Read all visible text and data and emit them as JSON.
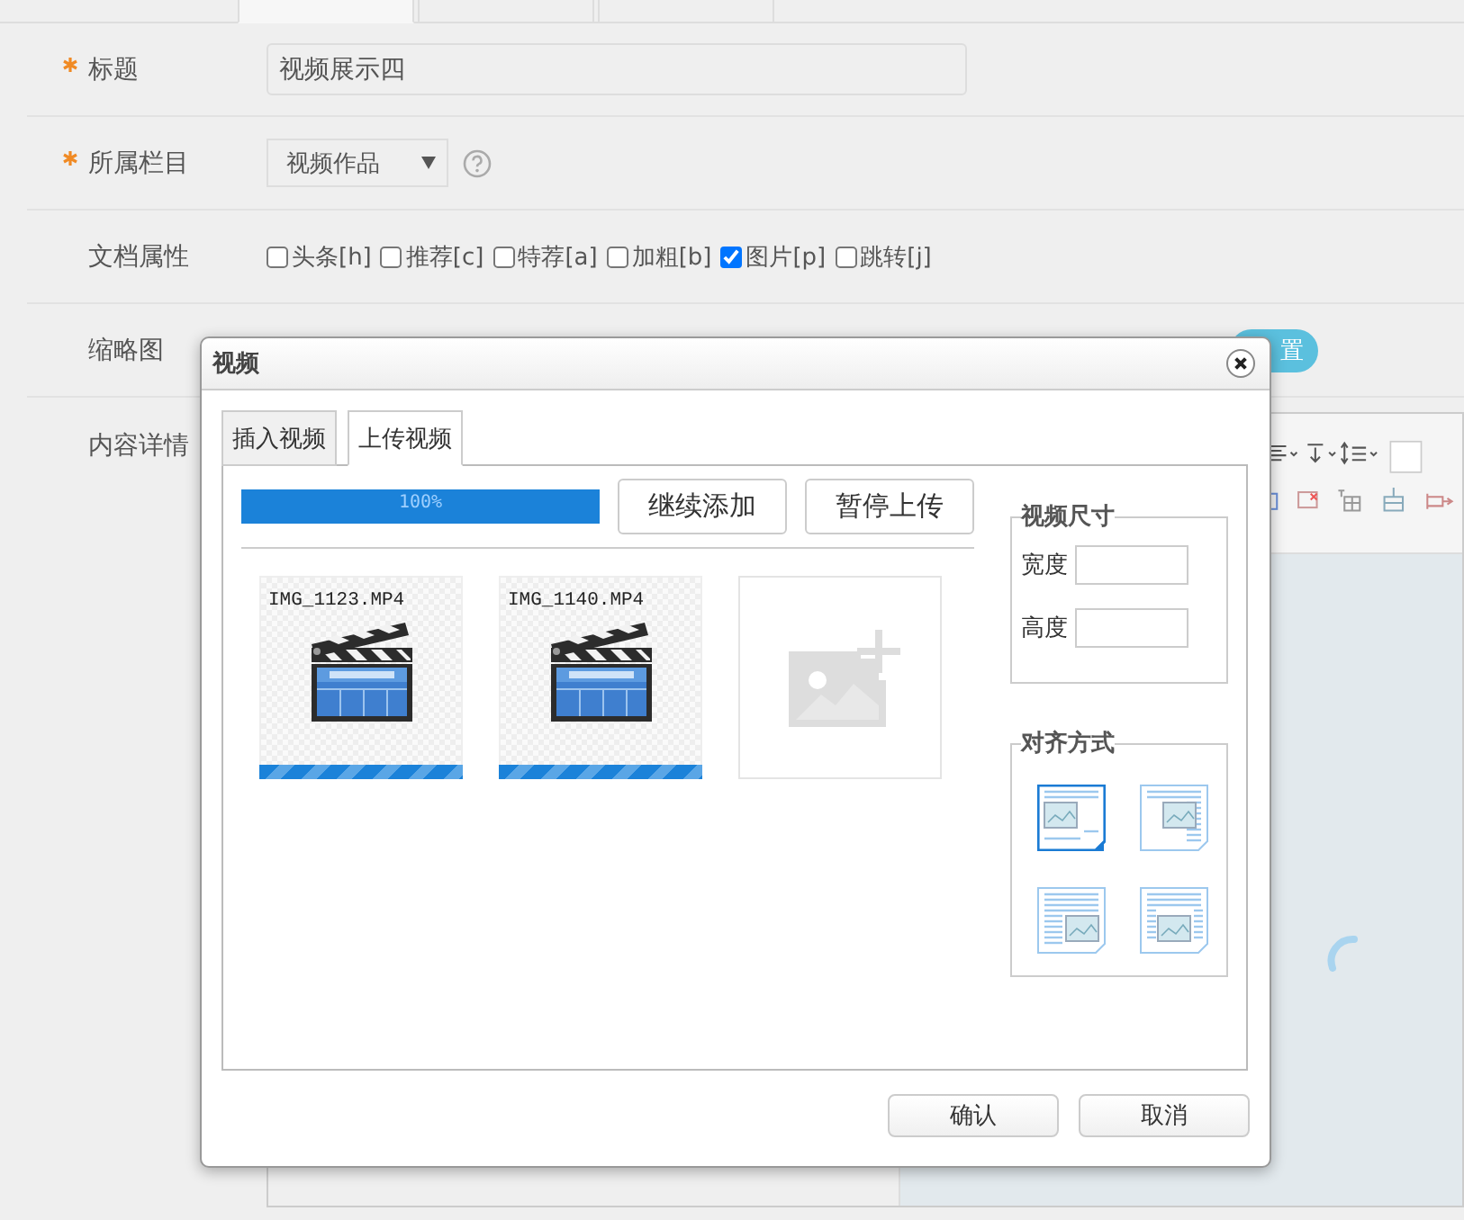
{
  "page_tabs": [
    {
      "selected": true
    },
    {
      "selected": false
    },
    {
      "selected": false
    }
  ],
  "form": {
    "rows": [
      {
        "kind": "text",
        "label": "标题",
        "required": true,
        "value": "视频展示四"
      },
      {
        "kind": "select",
        "label": "所属栏目",
        "required": true,
        "value": "视频作品"
      },
      {
        "kind": "checks",
        "label": "文档属性",
        "required": false,
        "options": [
          {
            "label": "头条[h]",
            "checked": false
          },
          {
            "label": "推荐[c]",
            "checked": false
          },
          {
            "label": "特荐[a]",
            "checked": false
          },
          {
            "label": "加粗[b]",
            "checked": false
          },
          {
            "label": "图片[p]",
            "checked": true
          },
          {
            "label": "跳转[j]",
            "checked": false
          }
        ]
      },
      {
        "kind": "thumb",
        "label": "缩略图",
        "required": false,
        "button": "置"
      },
      {
        "kind": "editor",
        "label": "内容详情",
        "required": false
      }
    ]
  },
  "dialog": {
    "title": "视频",
    "tabs": [
      {
        "label": "插入视频",
        "selected": false
      },
      {
        "label": "上传视频",
        "selected": true
      }
    ],
    "progress": {
      "level": 1,
      "reading": "100%"
    },
    "actions": [
      "继续添加",
      "暂停上传"
    ],
    "files": [
      {
        "kind": "video",
        "name": "IMG_1123.MP4"
      },
      {
        "kind": "video",
        "name": "IMG_1140.MP4"
      },
      {
        "kind": "add"
      }
    ],
    "size": {
      "legend": "视频尺寸",
      "fields": [
        {
          "label": "宽度"
        },
        {
          "label": "高度"
        }
      ]
    },
    "align": {
      "legend": "对齐方式",
      "options": [
        {
          "selected": true
        },
        {
          "selected": false
        },
        {
          "selected": false
        },
        {
          "selected": false
        }
      ]
    },
    "buttons": [
      "确认",
      "取消"
    ]
  }
}
